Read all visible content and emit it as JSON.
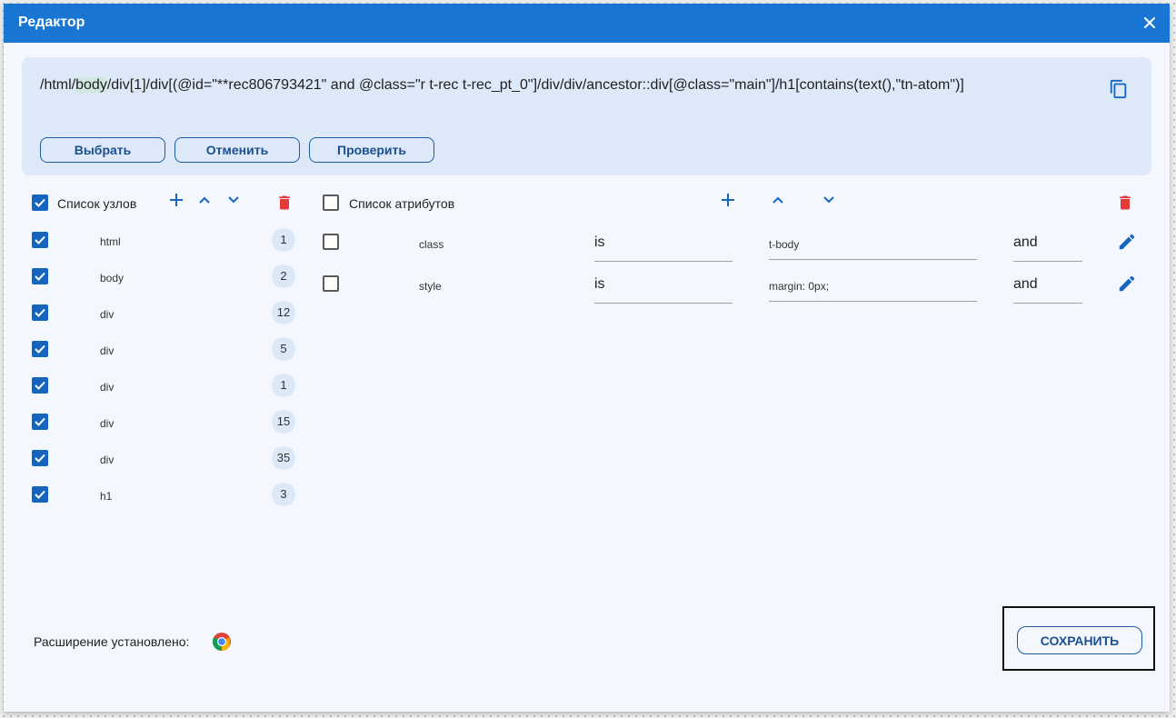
{
  "dialog": {
    "title": "Редактор",
    "close_icon": "close-icon"
  },
  "xpath": {
    "before": "/html/",
    "highlight": "body",
    "after": "/div[1]/div[(@id=\"**rec806793421\" and @class=\"r t-rec t-rec_pt_0\"]/div/div/ancestor::div[@class=\"main\"]/h1[contains(text(),\"tn-atom\")]",
    "copy_icon": "copy-icon",
    "buttons": {
      "select": "Выбрать",
      "cancel": "Отменить",
      "check": "Проверить"
    }
  },
  "nodes": {
    "header": "Список узлов",
    "all_checked": true,
    "items": [
      {
        "label": "html",
        "count": "1",
        "checked": true
      },
      {
        "label": "body",
        "count": "2",
        "checked": true
      },
      {
        "label": "div",
        "count": "12",
        "checked": true
      },
      {
        "label": "div",
        "count": "5",
        "checked": true
      },
      {
        "label": "div",
        "count": "1",
        "checked": true
      },
      {
        "label": "div",
        "count": "15",
        "checked": true
      },
      {
        "label": "div",
        "count": "35",
        "checked": true
      },
      {
        "label": "h1",
        "count": "3",
        "checked": true
      }
    ]
  },
  "attributes": {
    "header": "Список атрибутов",
    "all_checked": false,
    "items": [
      {
        "name": "class",
        "operator": "is",
        "value": "t-body",
        "logic": "and",
        "checked": false
      },
      {
        "name": "style",
        "operator": "is",
        "value": "margin: 0px;",
        "logic": "and",
        "checked": false
      }
    ]
  },
  "footer": {
    "extension_label": "Расширение установлено:",
    "browser_icon": "chrome-icon",
    "save": "СОХРАНИТЬ"
  },
  "colors": {
    "primary": "#1976d2",
    "checkbox": "#1565c0",
    "delete": "#e53935",
    "panel": "#dde9f8"
  }
}
